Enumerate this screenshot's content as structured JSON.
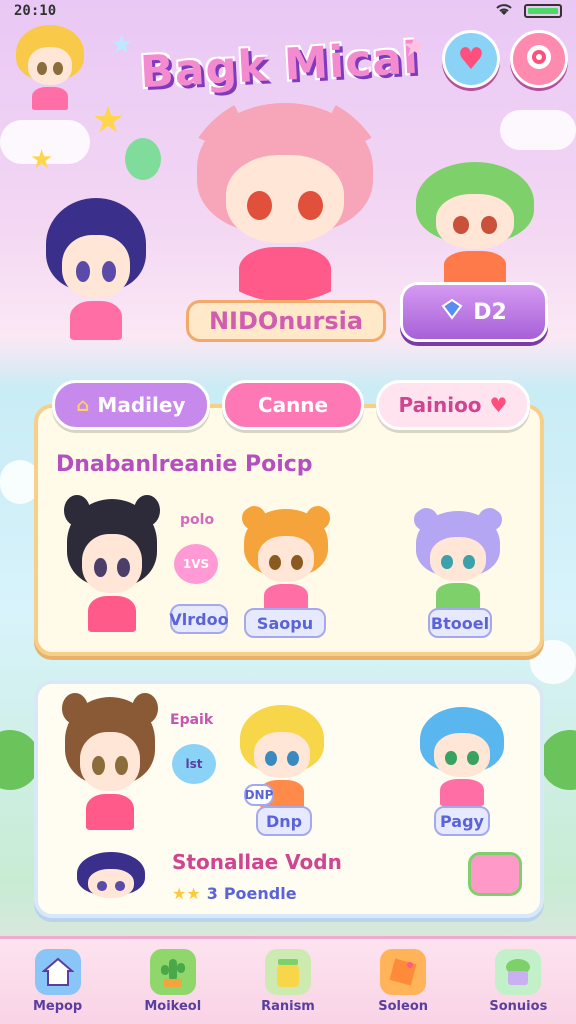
{
  "status_bar": {
    "time": "20:10"
  },
  "header": {
    "title": "Bagk Mical"
  },
  "player": {
    "name": "NIDOnursia"
  },
  "currency": {
    "gems": "D2"
  },
  "tabs": [
    {
      "label": "Madiley"
    },
    {
      "label": "Canne"
    },
    {
      "label": "Painioo"
    }
  ],
  "panel1": {
    "title": "Dnabanlreanie Poicp",
    "small_text": "polo",
    "badge_text": "1VS",
    "labels": [
      "Vlrdoo",
      "Saopu",
      "Btooel"
    ]
  },
  "panel2": {
    "small_text_top": "Epaik",
    "badge_text": "lst",
    "labels": [
      "DNP",
      "Dnp",
      "Pagy"
    ],
    "subtitle": "Stonallae Vodn",
    "stars_text": "3",
    "stars_label": "Poendle"
  },
  "nav": [
    {
      "label": "Mepop",
      "icon": "house-icon"
    },
    {
      "label": "Moikeol",
      "icon": "cactus-icon"
    },
    {
      "label": "Ranism",
      "icon": "jar-icon"
    },
    {
      "label": "Soleon",
      "icon": "tag-icon"
    },
    {
      "label": "Sonuios",
      "icon": "cake-icon"
    }
  ],
  "colors": {
    "accent": "#f48ad0",
    "purple": "#a760d8",
    "panel": "#fffbe8"
  }
}
